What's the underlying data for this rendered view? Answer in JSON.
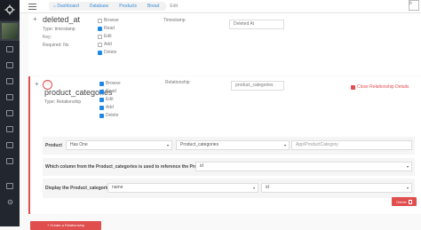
{
  "topbar": {
    "breadcrumbs": [
      "Dashboard",
      "Database",
      "Products",
      "Bread",
      "Edit"
    ],
    "broken_image_text": "b"
  },
  "field": {
    "plus": "+",
    "name": "deleted_at",
    "type": "Type: timestamp",
    "key": "Key:",
    "required": "Required: No",
    "column_type": "Timestamp",
    "display_name": "Deleted At",
    "checks": [
      {
        "label": "Browse",
        "checked": false
      },
      {
        "label": "Read",
        "checked": true
      },
      {
        "label": "Edit",
        "checked": false
      },
      {
        "label": "Add",
        "checked": false
      },
      {
        "label": "Delete",
        "checked": true
      }
    ]
  },
  "relationship": {
    "plus": "+",
    "heart": "♡",
    "name": "product_categories",
    "type": "Type: Relationship",
    "column_type": "Relationship",
    "display_name": "product_categories",
    "close_label": "Close Relationship Details",
    "checks": [
      {
        "label": "Browse",
        "checked": true
      },
      {
        "label": "Read",
        "checked": true
      },
      {
        "label": "Edit",
        "checked": true
      },
      {
        "label": "Add",
        "checked": true
      },
      {
        "label": "Delete",
        "checked": true
      }
    ],
    "row1": {
      "model_label": "Product",
      "rel_type": "Has One",
      "table": "Product_categories",
      "model": "App\\ProductCategory"
    },
    "row2": {
      "question": "Which column from the Product_categories is used to reference the Product?",
      "value": "id"
    },
    "row3": {
      "question": "Display the Product_categories",
      "value": "name",
      "store": "id"
    },
    "delete_label": "Delete",
    "create_label": "+ Create a Relationship"
  },
  "colors": {
    "accent": "#e04e4e",
    "checkbox": "#1e88e5",
    "sidebar": "#22262e",
    "link": "#3b8edb"
  }
}
